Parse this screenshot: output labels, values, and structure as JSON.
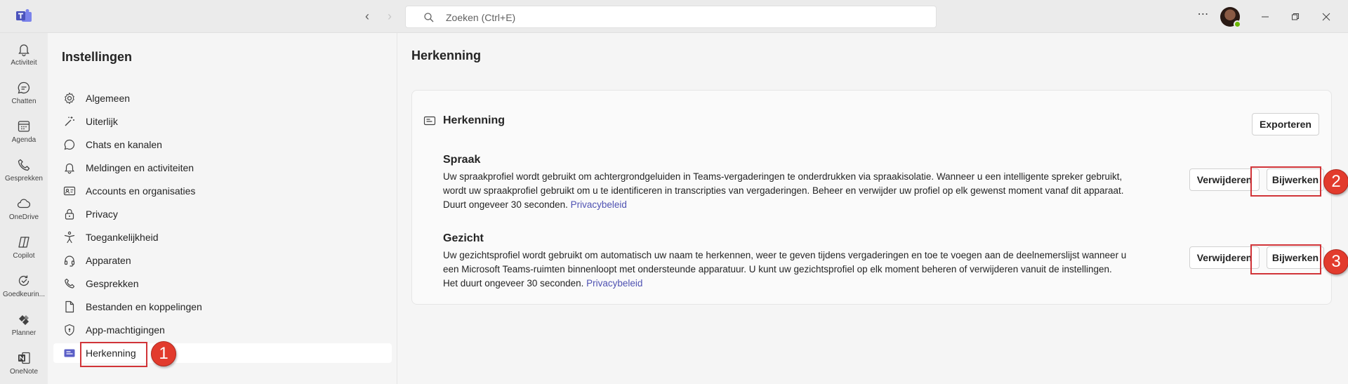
{
  "titlebar": {
    "search_placeholder": "Zoeken (Ctrl+E)"
  },
  "rail": {
    "items": [
      {
        "label": "Activiteit",
        "icon": "bell-icon"
      },
      {
        "label": "Chatten",
        "icon": "chat-icon"
      },
      {
        "label": "Agenda",
        "icon": "calendar-icon"
      },
      {
        "label": "Gesprekken",
        "icon": "phone-icon"
      },
      {
        "label": "OneDrive",
        "icon": "cloud-icon"
      },
      {
        "label": "Copilot",
        "icon": "copilot-icon"
      },
      {
        "label": "Goedkeurin...",
        "icon": "approvals-icon"
      },
      {
        "label": "Planner",
        "icon": "planner-icon"
      },
      {
        "label": "OneNote",
        "icon": "onenote-icon"
      }
    ]
  },
  "settings": {
    "title": "Instellingen",
    "items": [
      {
        "label": "Algemeen",
        "icon": "gear-icon"
      },
      {
        "label": "Uiterlijk",
        "icon": "wand-icon"
      },
      {
        "label": "Chats en kanalen",
        "icon": "chat-icon"
      },
      {
        "label": "Meldingen en activiteiten",
        "icon": "bell-icon"
      },
      {
        "label": "Accounts en organisaties",
        "icon": "id-card-icon"
      },
      {
        "label": "Privacy",
        "icon": "lock-icon"
      },
      {
        "label": "Toegankelijkheid",
        "icon": "accessibility-icon"
      },
      {
        "label": "Apparaten",
        "icon": "headset-icon"
      },
      {
        "label": "Gesprekken",
        "icon": "phone-icon"
      },
      {
        "label": "Bestanden en koppelingen",
        "icon": "document-icon"
      },
      {
        "label": "App-machtigingen",
        "icon": "shield-icon"
      },
      {
        "label": "Herkenning",
        "icon": "recognition-icon"
      }
    ],
    "active_index": 11
  },
  "main": {
    "page_title": "Herkenning",
    "card": {
      "title": "Herkenning",
      "export_label": "Exporteren",
      "sections": [
        {
          "heading": "Spraak",
          "lines": [
            "Uw spraakprofiel wordt gebruikt om achtergrondgeluiden in Teams-vergaderingen te onderdrukken via spraakisolatie. Wanneer u een intelligente spreker gebruikt,",
            "wordt uw spraakprofiel gebruikt om u te identificeren in transcripties van vergaderingen. Beheer en verwijder uw profiel op elk gewenst moment vanaf dit apparaat.",
            "Duurt ongeveer 30 seconden."
          ],
          "link": "Privacybeleid",
          "delete_label": "Verwijderen",
          "update_label": "Bijwerken"
        },
        {
          "heading": "Gezicht",
          "lines": [
            "Uw gezichtsprofiel wordt gebruikt om automatisch uw naam te herkennen, weer te geven tijdens vergaderingen en toe te voegen aan de deelnemerslijst wanneer u",
            "een Microsoft Teams-ruimten binnenloopt met ondersteunde apparatuur. U kunt uw gezichtsprofiel op elk moment beheren of verwijderen vanuit de instellingen.",
            "Het duurt ongeveer 30 seconden."
          ],
          "link": "Privacybeleid",
          "delete_label": "Verwijderen",
          "update_label": "Bijwerken"
        }
      ]
    }
  },
  "annotations": {
    "badges": [
      "1",
      "2",
      "3"
    ],
    "color": "#e23b2d"
  },
  "colors": {
    "accent": "#5b5fc7",
    "link": "#4f52b2",
    "presence": "#6bb700"
  }
}
